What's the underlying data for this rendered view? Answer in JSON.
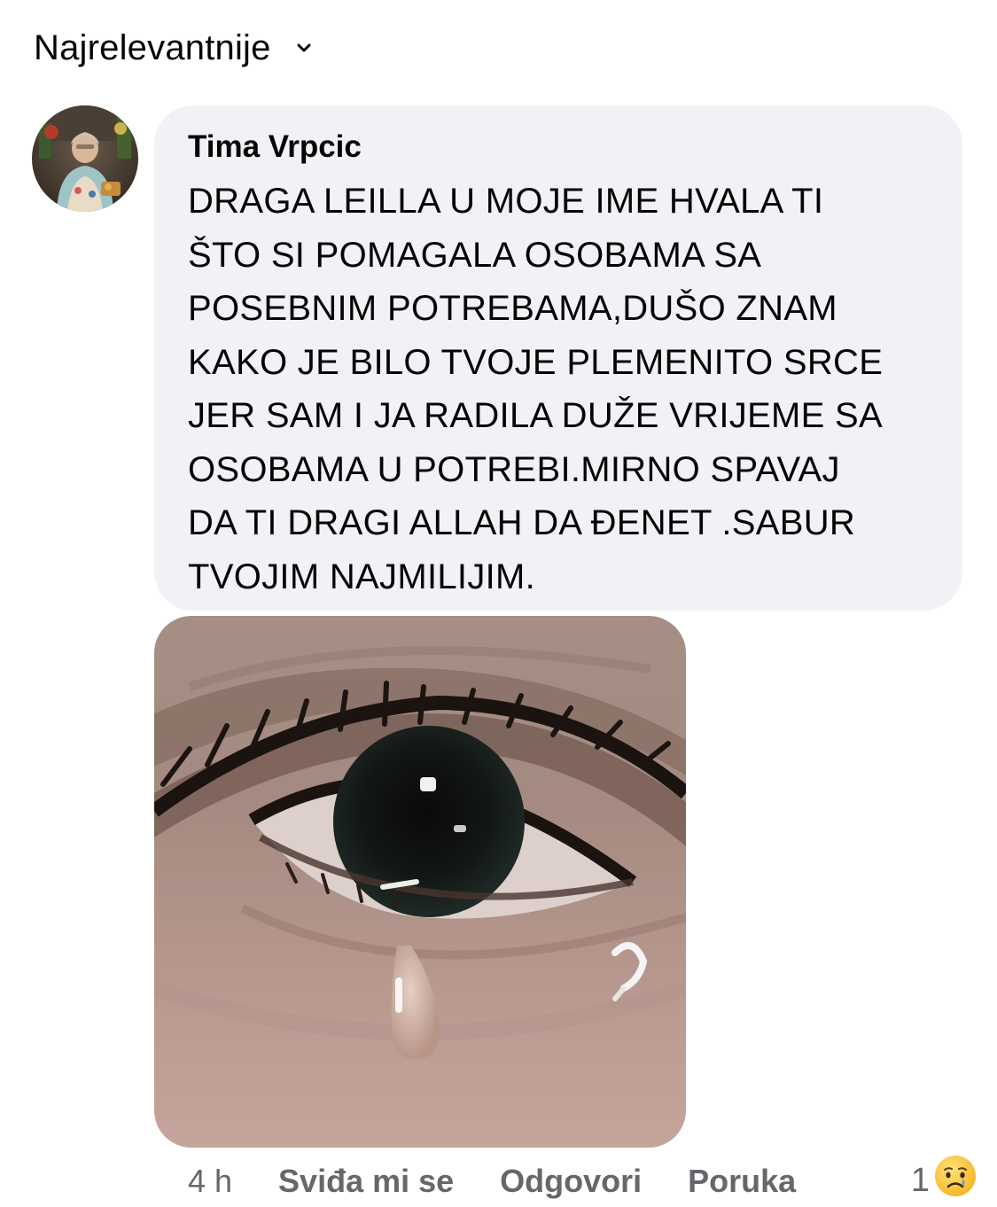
{
  "sort": {
    "label": "Najrelevantnije",
    "icon": "chevron-down-icon"
  },
  "comment": {
    "author": "Tima Vrpcic",
    "text": "DRAGA LEILLA U MOJE IME HVALA TI\nŠTO SI POMAGALA OSOBAMA SA\nPOSEBNIM POTREBAMA,DUŠO ZNAM\nKAKO JE BILO TVOJE PLEMENITO SRCE\nJER SAM I JA RADILA DUŽE VRIJEME SA\nOSOBAMA U POTREBI.MIRNO SPAVAJ\nDA TI DRAGI ALLAH DA ĐENET .SABUR\nTVOJIM NAJMILIJIM.",
    "bubble_color": "#f0f2f5"
  },
  "actions": {
    "time": "4 h",
    "like": "Sviđa mi se",
    "reply": "Odgovori",
    "message": "Poruka"
  },
  "reactions": {
    "count": "1",
    "icon": "sad-emoji-icon"
  },
  "colors": {
    "text_primary": "#050505",
    "text_secondary": "#65676b"
  }
}
